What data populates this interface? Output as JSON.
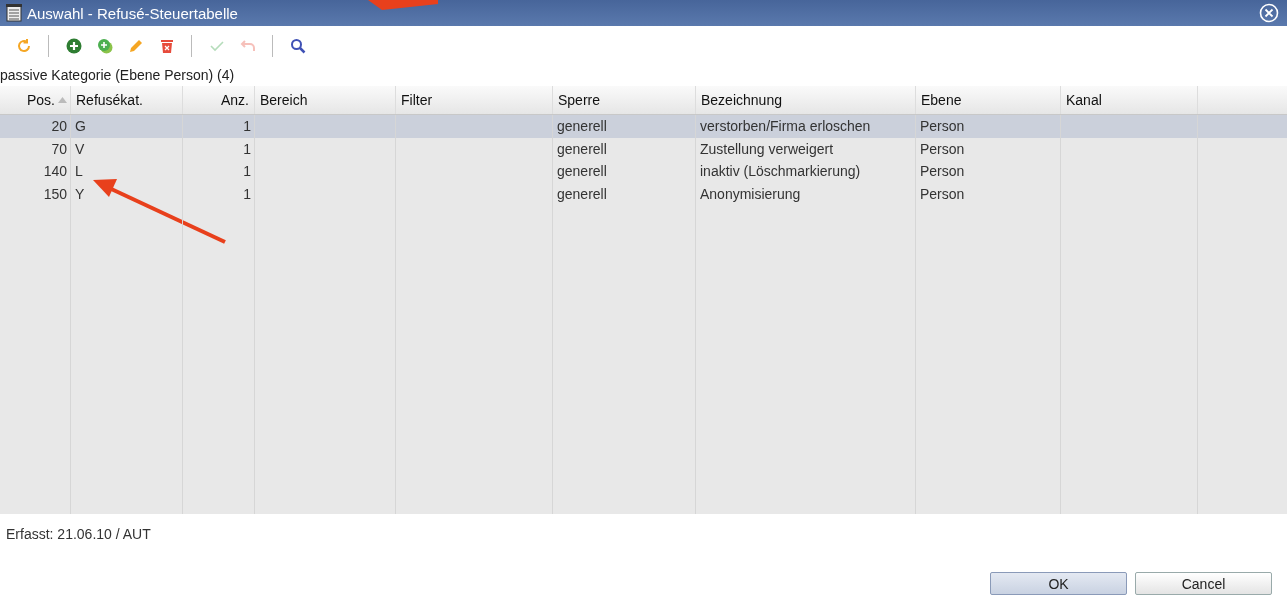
{
  "window": {
    "title": "Auswahl - Refusé-Steuertabelle"
  },
  "toolbar": [
    {
      "kind": "refresh",
      "disabled": false
    },
    {
      "kind": "separator"
    },
    {
      "kind": "add",
      "disabled": false
    },
    {
      "kind": "copy",
      "disabled": false
    },
    {
      "kind": "edit",
      "disabled": false
    },
    {
      "kind": "delete",
      "disabled": false
    },
    {
      "kind": "separator"
    },
    {
      "kind": "confirm",
      "disabled": true
    },
    {
      "kind": "undo",
      "disabled": true
    },
    {
      "kind": "separator"
    },
    {
      "kind": "search",
      "disabled": false
    }
  ],
  "caption": "passive Kategorie (Ebene Person) (4)",
  "table": {
    "columns": [
      {
        "label": "Pos.",
        "sorted": true
      },
      {
        "label": "Refusékat.",
        "sorted": false
      },
      {
        "label": "Anz.",
        "sorted": false
      },
      {
        "label": "Bereich",
        "sorted": false
      },
      {
        "label": "Filter",
        "sorted": false
      },
      {
        "label": "Sperre",
        "sorted": false
      },
      {
        "label": "Bezeichnung",
        "sorted": false
      },
      {
        "label": "Ebene",
        "sorted": false
      },
      {
        "label": "Kanal",
        "sorted": false
      }
    ],
    "rows": [
      {
        "selected": true,
        "cells": [
          "20",
          "G",
          "1",
          "",
          "",
          "generell",
          "verstorben/Firma erloschen",
          "Person",
          ""
        ]
      },
      {
        "selected": false,
        "cells": [
          "70",
          "V",
          "1",
          "",
          "",
          "generell",
          "Zustellung verweigert",
          "Person",
          ""
        ]
      },
      {
        "selected": false,
        "cells": [
          "140",
          "L",
          "1",
          "",
          "",
          "generell",
          "inaktiv (Löschmarkierung)",
          "Person",
          ""
        ]
      },
      {
        "selected": false,
        "cells": [
          "150",
          "Y",
          "1",
          "",
          "",
          "generell",
          "Anonymisierung",
          "Person",
          ""
        ]
      }
    ]
  },
  "footer": {
    "info": "Erfasst: 21.06.10 / AUT"
  },
  "buttons": [
    {
      "label": "OK",
      "default": true
    },
    {
      "label": "Cancel",
      "default": false
    }
  ]
}
